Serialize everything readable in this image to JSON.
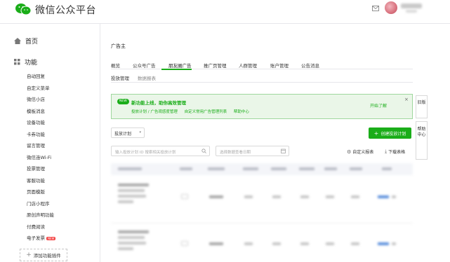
{
  "header": {
    "app_title": "微信公众平台"
  },
  "sidebar": {
    "home_label": "首页",
    "features_label": "功能",
    "items": [
      {
        "label": "自动回复"
      },
      {
        "label": "自定义菜单"
      },
      {
        "label": "微信小店"
      },
      {
        "label": "模板消息"
      },
      {
        "label": "设备功能"
      },
      {
        "label": "卡券功能"
      },
      {
        "label": "留言管理"
      },
      {
        "label": "微信连Wi-Fi"
      },
      {
        "label": "投票管理"
      },
      {
        "label": "客服功能"
      },
      {
        "label": "页面模版"
      },
      {
        "label": "门店小程序"
      },
      {
        "label": "原创声明功能"
      },
      {
        "label": "付费阅读"
      },
      {
        "label": "电子发票",
        "badge": "NEW"
      }
    ],
    "add_plugin_label": "添加功能插件"
  },
  "main": {
    "page_title": "广告主",
    "tabs": [
      {
        "label": "概览"
      },
      {
        "label": "公众号广告"
      },
      {
        "label": "朋友圈广告"
      },
      {
        "label": "推广页管理"
      },
      {
        "label": "人群管理"
      },
      {
        "label": "账户管理"
      },
      {
        "label": "公告消息"
      }
    ],
    "active_tab": "朋友圈广告",
    "subtabs": [
      {
        "label": "投放管理"
      },
      {
        "label": "数据报表"
      }
    ]
  },
  "notice": {
    "tag": "NEW",
    "title": "新功能上线，助你高效管理",
    "links": [
      "投放计划 / 广告观感度管理",
      "自定义常用广告管理列表",
      "帮助中心"
    ],
    "start_label": "开始了解",
    "close": "×"
  },
  "float_panel": {
    "old_label": "旧版",
    "help_label": "帮助中心"
  },
  "toolbar": {
    "plan_select_value": "投放计划",
    "create_button_label": "创建投放计划",
    "search_placeholder": "输入投放计划 ID 搜索相关投放计划",
    "date_placeholder": "选择数据查看日期",
    "custom_report_label": "自定义报表",
    "download_label": "下载表格"
  },
  "colors": {
    "brand_green": "#1aad19",
    "notice_bg": "#eaf6e8",
    "link_blue": "#5a8fdc"
  }
}
